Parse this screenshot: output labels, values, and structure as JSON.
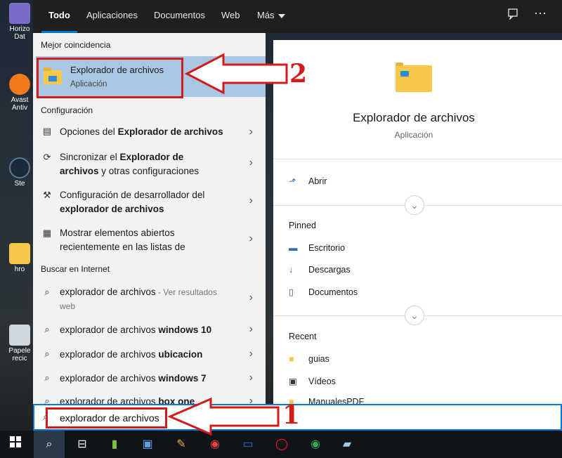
{
  "desktop": {
    "icons": [
      {
        "label": "Horizo Dat",
        "color": "#7b6cc9"
      },
      {
        "label": "Avast Antiv",
        "color": "#f07b18"
      },
      {
        "label": "Ste",
        "color": "#1b2838"
      },
      {
        "label": "hro",
        "color": "#f6c94a"
      },
      {
        "label": "Papele recic",
        "color": "#cfd8de"
      }
    ]
  },
  "tabs": [
    {
      "label": "Todo",
      "active": true
    },
    {
      "label": "Aplicaciones"
    },
    {
      "label": "Documentos"
    },
    {
      "label": "Web"
    },
    {
      "label": "Más"
    }
  ],
  "topbar_icons": [
    "feedback-icon",
    "more-options-icon"
  ],
  "left": {
    "best_match_heading": "Mejor coincidencia",
    "best_match": {
      "title": "Explorador de archivos",
      "subtitle": "Aplicación"
    },
    "config_heading": "Configuración",
    "config_items": [
      {
        "icon": "folder-options-icon",
        "pre": "Opciones del ",
        "bold": "Explorador de archivos",
        "post": ""
      },
      {
        "icon": "sync-icon",
        "pre": "Sincronizar el ",
        "bold": "Explorador de",
        "post": "",
        "line2_bold": "archivos",
        "line2": " y otras configuraciones"
      },
      {
        "icon": "developer-tools-icon",
        "pre": "Configuración de desarrollador del",
        "bold": "",
        "post": "",
        "line2_bold": "explorador de archivos",
        "line2": ""
      },
      {
        "icon": "taskbar-icon",
        "pre": "Mostrar elementos abiertos",
        "bold": "",
        "post": "",
        "line2_bold": "",
        "line2": "recientemente en las listas de"
      }
    ],
    "internet_heading": "Buscar en Internet",
    "web_items": [
      {
        "pre": "explorador de archivos",
        "bold": "",
        "suffix": " - Ver resultados",
        "line2": "web"
      },
      {
        "pre": "explorador de archivos ",
        "bold": "windows 10",
        "suffix": "",
        "line2": ""
      },
      {
        "pre": "explorador de archivos ",
        "bold": "ubicacion",
        "suffix": "",
        "line2": ""
      },
      {
        "pre": "explorador de archivos ",
        "bold": "windows 7",
        "suffix": "",
        "line2": ""
      },
      {
        "pre": "explorador de archivos ",
        "bold": "box one",
        "suffix": "",
        "line2": ""
      }
    ]
  },
  "right": {
    "title": "Explorador de archivos",
    "subtitle": "Aplicación",
    "open_label": "Abrir",
    "pinned_heading": "Pinned",
    "pinned": [
      "Escritorio",
      "Descargas",
      "Documentos"
    ],
    "recent_heading": "Recent",
    "recent": [
      "guias",
      "Vídeos",
      "ManualesPDF"
    ]
  },
  "search": {
    "value": "explorador de archivos"
  },
  "annotations": {
    "label1": "1",
    "label2": "2",
    "color": "#d21b1b"
  },
  "taskbar": [
    "windows-start-icon",
    "search-icon",
    "task-view-icon",
    "notepad-app-icon",
    "store-icon",
    "paint-icon",
    "chrome-icon",
    "display-app-icon",
    "opera-icon",
    "chrome-alt-icon",
    "files-app-icon"
  ]
}
